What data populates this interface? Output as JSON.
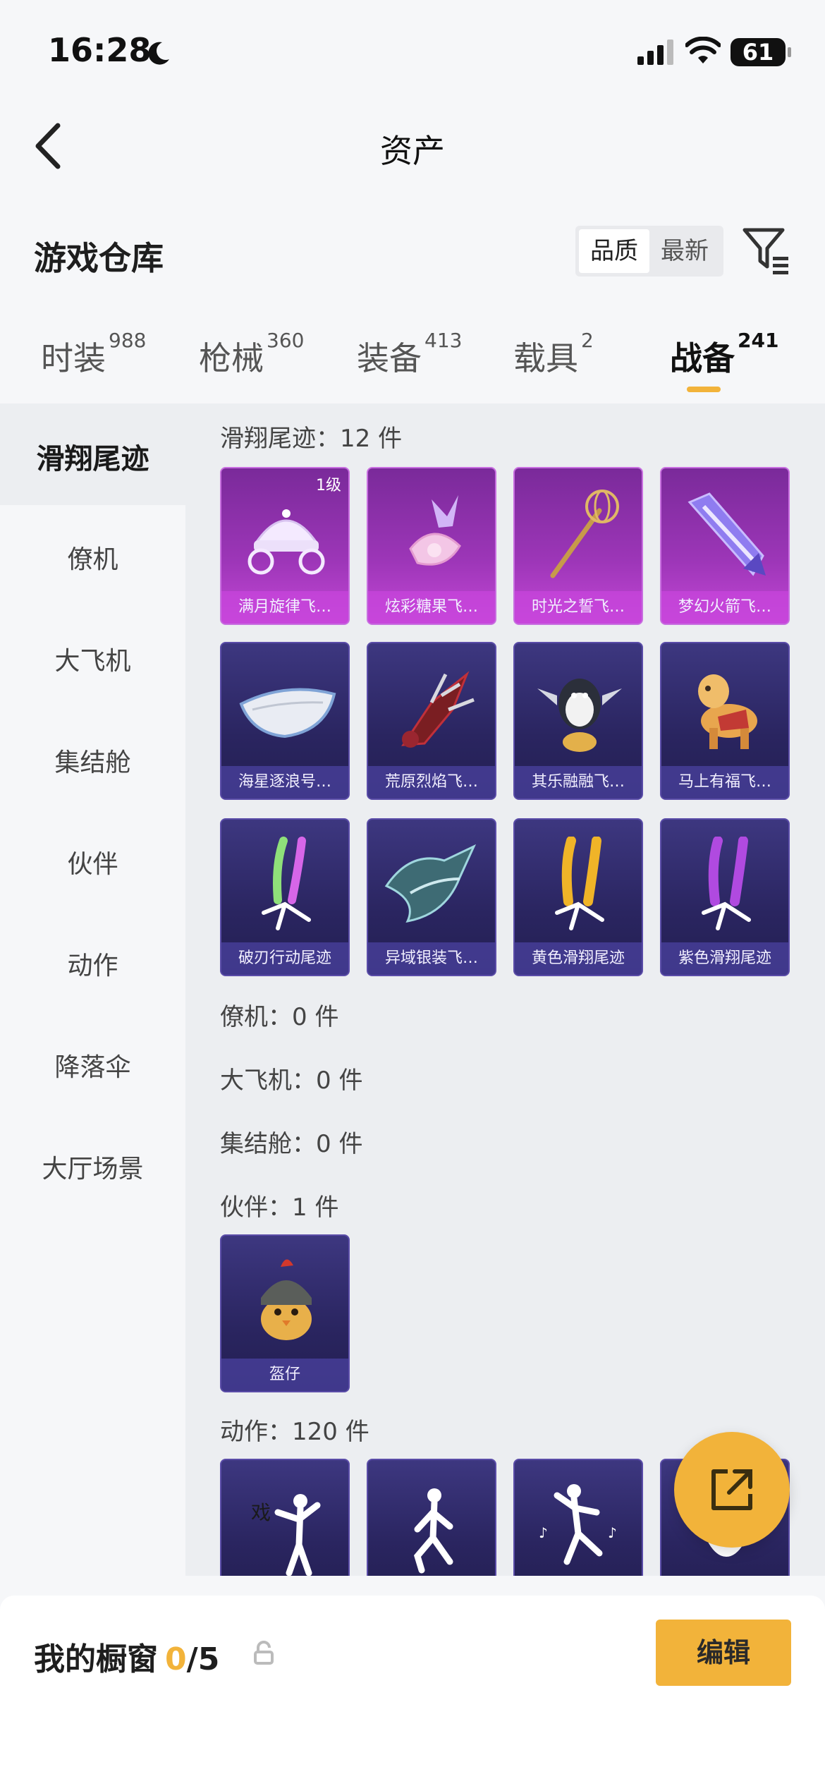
{
  "status_bar": {
    "time": "16:28",
    "battery": "61"
  },
  "nav": {
    "title": "资产"
  },
  "header": {
    "title": "游戏仓库",
    "sort_options": [
      "品质",
      "最新"
    ]
  },
  "tabs": [
    {
      "label": "时装",
      "count": "988"
    },
    {
      "label": "枪械",
      "count": "360"
    },
    {
      "label": "装备",
      "count": "413"
    },
    {
      "label": "载具",
      "count": "2"
    },
    {
      "label": "战备",
      "count": "241"
    }
  ],
  "sidebar": [
    "滑翔尾迹",
    "僚机",
    "大飞机",
    "集结舱",
    "伙伴",
    "动作",
    "降落伞",
    "大厅场景"
  ],
  "sections": {
    "trail": "滑翔尾迹：12 件",
    "wingman": "僚机：0 件",
    "plane": "大飞机：0 件",
    "pod": "集结舱：0 件",
    "partner": "伙伴：1 件",
    "action": "动作：120 件"
  },
  "trail_items": [
    {
      "label": "满月旋律飞…",
      "level": "1级"
    },
    {
      "label": "炫彩糖果飞…"
    },
    {
      "label": "时光之誓飞…"
    },
    {
      "label": "梦幻火箭飞…"
    },
    {
      "label": "海星逐浪号…"
    },
    {
      "label": "荒原烈焰飞…"
    },
    {
      "label": "其乐融融飞…"
    },
    {
      "label": "马上有福飞…"
    },
    {
      "label": "破刃行动尾迹"
    },
    {
      "label": "异域银装飞…"
    },
    {
      "label": "黄色滑翔尾迹"
    },
    {
      "label": "紫色滑翔尾迹"
    }
  ],
  "partner_items": [
    {
      "label": "盔仔"
    }
  ],
  "bottom": {
    "showcase_label": "我的橱窗",
    "count": "0",
    "total": "/5",
    "edit_label": "编辑"
  },
  "colors": {
    "accent": "#f2b33a",
    "card_purple": "#b03fc8",
    "card_blue": "#2e2866"
  }
}
